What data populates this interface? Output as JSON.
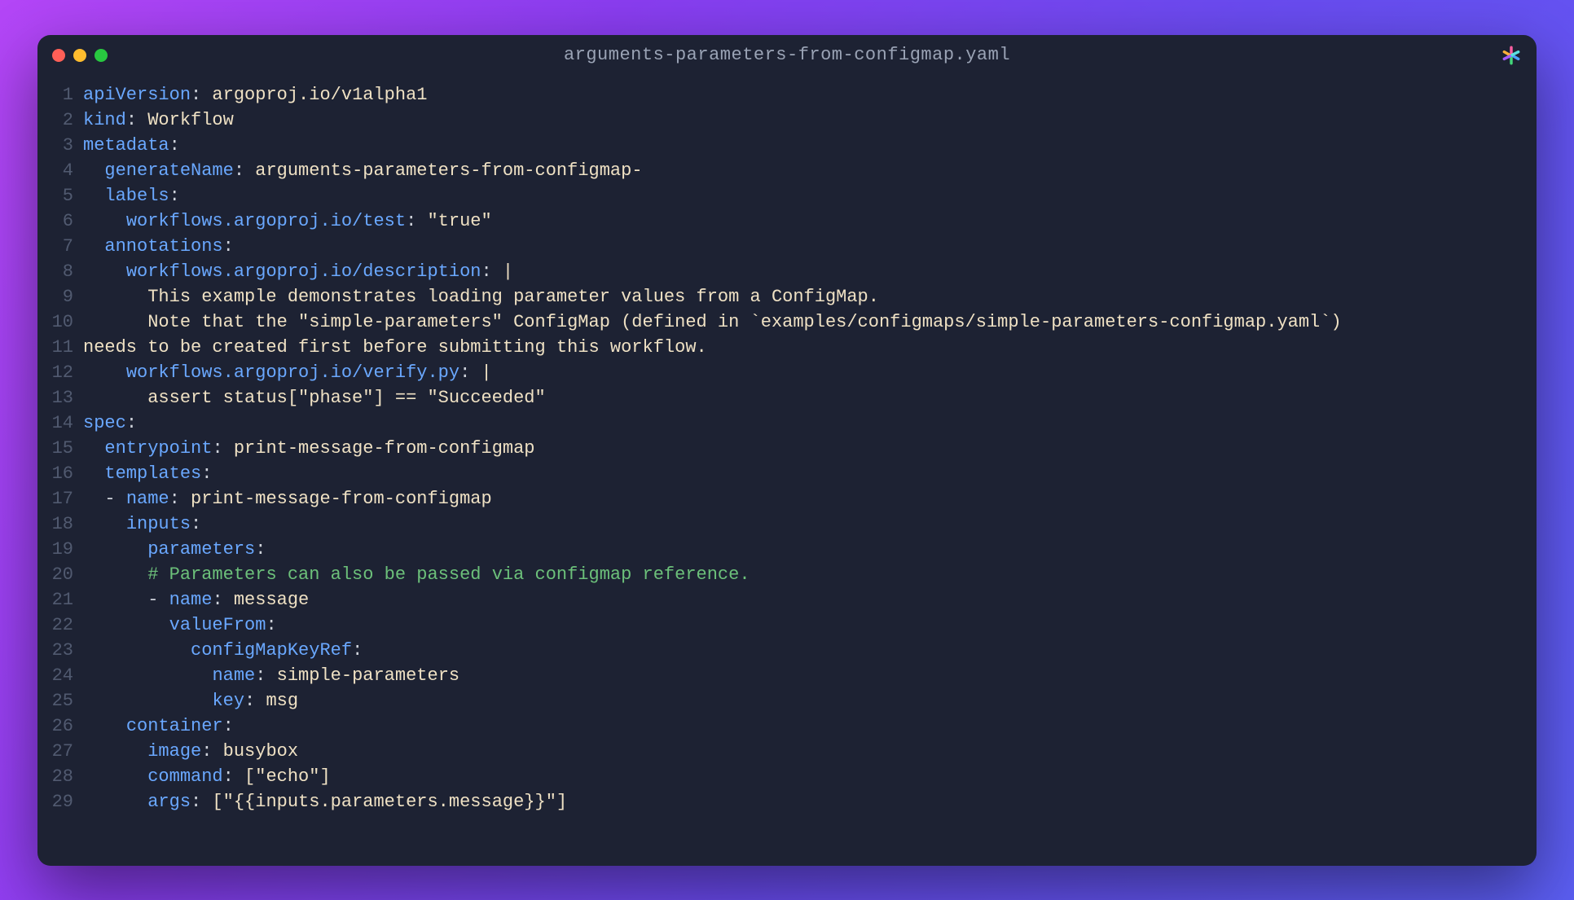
{
  "window": {
    "title": "arguments-parameters-from-configmap.yaml"
  },
  "traffic": {
    "red": "#ff5f57",
    "yellow": "#febc2e",
    "green": "#28c840"
  },
  "spark_icon": "spark-icon",
  "colors": {
    "bg_start": "#b446f7",
    "bg_end": "#5b5ef2",
    "editor_bg": "#1d2233",
    "key": "#6aa8ff",
    "string": "#efe1c4",
    "comment": "#6cc07a",
    "gutter": "#515a70",
    "title": "#9aa3b5"
  },
  "lines": [
    {
      "n": 1,
      "segs": [
        {
          "c": "key",
          "t": "apiVersion"
        },
        {
          "c": "punct",
          "t": ":"
        },
        {
          "c": "str",
          "t": " argoproj.io/v1alpha1"
        }
      ]
    },
    {
      "n": 2,
      "segs": [
        {
          "c": "key",
          "t": "kind"
        },
        {
          "c": "punct",
          "t": ":"
        },
        {
          "c": "str",
          "t": " Workflow"
        }
      ]
    },
    {
      "n": 3,
      "segs": [
        {
          "c": "key",
          "t": "metadata"
        },
        {
          "c": "punct",
          "t": ":"
        }
      ]
    },
    {
      "n": 4,
      "segs": [
        {
          "c": "",
          "t": "  "
        },
        {
          "c": "key",
          "t": "generateName"
        },
        {
          "c": "punct",
          "t": ":"
        },
        {
          "c": "str",
          "t": " arguments-parameters-from-configmap-"
        }
      ]
    },
    {
      "n": 5,
      "segs": [
        {
          "c": "",
          "t": "  "
        },
        {
          "c": "key",
          "t": "labels"
        },
        {
          "c": "punct",
          "t": ":"
        }
      ]
    },
    {
      "n": 6,
      "segs": [
        {
          "c": "",
          "t": "    "
        },
        {
          "c": "key",
          "t": "workflows.argoproj.io/test"
        },
        {
          "c": "punct",
          "t": ":"
        },
        {
          "c": "str",
          "t": " \"true\""
        }
      ]
    },
    {
      "n": 7,
      "segs": [
        {
          "c": "",
          "t": "  "
        },
        {
          "c": "key",
          "t": "annotations"
        },
        {
          "c": "punct",
          "t": ":"
        }
      ]
    },
    {
      "n": 8,
      "segs": [
        {
          "c": "",
          "t": "    "
        },
        {
          "c": "key",
          "t": "workflows.argoproj.io/description"
        },
        {
          "c": "punct",
          "t": ":"
        },
        {
          "c": "str",
          "t": " |"
        }
      ]
    },
    {
      "n": 9,
      "segs": [
        {
          "c": "str",
          "t": "      This example demonstrates loading parameter values from a ConfigMap."
        }
      ]
    },
    {
      "n": 10,
      "segs": [
        {
          "c": "str",
          "t": "      Note that the \"simple-parameters\" ConfigMap (defined in `examples/configmaps/simple-parameters-configmap.yaml`) "
        }
      ],
      "wrap": "needs to be created first before submitting this workflow."
    },
    {
      "n": 11,
      "segs": [
        {
          "c": "",
          "t": "    "
        },
        {
          "c": "key",
          "t": "workflows.argoproj.io/verify.py"
        },
        {
          "c": "punct",
          "t": ":"
        },
        {
          "c": "str",
          "t": " |"
        }
      ]
    },
    {
      "n": 12,
      "segs": [
        {
          "c": "str",
          "t": "      assert status[\"phase\"] == \"Succeeded\""
        }
      ]
    },
    {
      "n": 13,
      "segs": [
        {
          "c": "key",
          "t": "spec"
        },
        {
          "c": "punct",
          "t": ":"
        }
      ]
    },
    {
      "n": 14,
      "segs": [
        {
          "c": "",
          "t": "  "
        },
        {
          "c": "key",
          "t": "entrypoint"
        },
        {
          "c": "punct",
          "t": ":"
        },
        {
          "c": "str",
          "t": " print-message-from-configmap"
        }
      ]
    },
    {
      "n": 15,
      "segs": [
        {
          "c": "",
          "t": ""
        }
      ]
    },
    {
      "n": 16,
      "segs": [
        {
          "c": "",
          "t": "  "
        },
        {
          "c": "key",
          "t": "templates"
        },
        {
          "c": "punct",
          "t": ":"
        }
      ]
    },
    {
      "n": 17,
      "segs": [
        {
          "c": "",
          "t": "  "
        },
        {
          "c": "dash",
          "t": "- "
        },
        {
          "c": "key",
          "t": "name"
        },
        {
          "c": "punct",
          "t": ":"
        },
        {
          "c": "str",
          "t": " print-message-from-configmap"
        }
      ]
    },
    {
      "n": 18,
      "segs": [
        {
          "c": "",
          "t": "    "
        },
        {
          "c": "key",
          "t": "inputs"
        },
        {
          "c": "punct",
          "t": ":"
        }
      ]
    },
    {
      "n": 19,
      "segs": [
        {
          "c": "",
          "t": "      "
        },
        {
          "c": "key",
          "t": "parameters"
        },
        {
          "c": "punct",
          "t": ":"
        }
      ]
    },
    {
      "n": 20,
      "segs": [
        {
          "c": "",
          "t": "      "
        },
        {
          "c": "comment",
          "t": "# Parameters can also be passed via configmap reference."
        }
      ]
    },
    {
      "n": 21,
      "segs": [
        {
          "c": "",
          "t": "      "
        },
        {
          "c": "dash",
          "t": "- "
        },
        {
          "c": "key",
          "t": "name"
        },
        {
          "c": "punct",
          "t": ":"
        },
        {
          "c": "str",
          "t": " message"
        }
      ]
    },
    {
      "n": 22,
      "segs": [
        {
          "c": "",
          "t": "        "
        },
        {
          "c": "key",
          "t": "valueFrom"
        },
        {
          "c": "punct",
          "t": ":"
        }
      ]
    },
    {
      "n": 23,
      "segs": [
        {
          "c": "",
          "t": "          "
        },
        {
          "c": "key",
          "t": "configMapKeyRef"
        },
        {
          "c": "punct",
          "t": ":"
        }
      ]
    },
    {
      "n": 24,
      "segs": [
        {
          "c": "",
          "t": "            "
        },
        {
          "c": "key",
          "t": "name"
        },
        {
          "c": "punct",
          "t": ":"
        },
        {
          "c": "str",
          "t": " simple-parameters"
        }
      ]
    },
    {
      "n": 25,
      "segs": [
        {
          "c": "",
          "t": "            "
        },
        {
          "c": "key",
          "t": "key"
        },
        {
          "c": "punct",
          "t": ":"
        },
        {
          "c": "str",
          "t": " msg"
        }
      ]
    },
    {
      "n": 26,
      "segs": [
        {
          "c": "",
          "t": "    "
        },
        {
          "c": "key",
          "t": "container"
        },
        {
          "c": "punct",
          "t": ":"
        }
      ]
    },
    {
      "n": 27,
      "segs": [
        {
          "c": "",
          "t": "      "
        },
        {
          "c": "key",
          "t": "image"
        },
        {
          "c": "punct",
          "t": ":"
        },
        {
          "c": "str",
          "t": " busybox"
        }
      ]
    },
    {
      "n": 28,
      "segs": [
        {
          "c": "",
          "t": "      "
        },
        {
          "c": "key",
          "t": "command"
        },
        {
          "c": "punct",
          "t": ":"
        },
        {
          "c": "str",
          "t": " [\"echo\"]"
        }
      ]
    },
    {
      "n": 29,
      "segs": [
        {
          "c": "",
          "t": "      "
        },
        {
          "c": "key",
          "t": "args"
        },
        {
          "c": "punct",
          "t": ":"
        },
        {
          "c": "str",
          "t": " [\"{{inputs.parameters.message}}\"]"
        }
      ]
    }
  ]
}
